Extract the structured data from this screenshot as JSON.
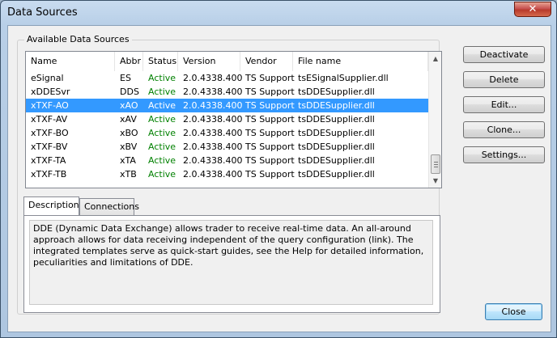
{
  "window": {
    "title": "Data Sources",
    "close_glyph": "✕"
  },
  "group": {
    "title": "Available Data Sources"
  },
  "table": {
    "columns": [
      "Name",
      "Abbr",
      "Status",
      "Version",
      "Vendor",
      "File name"
    ],
    "rows": [
      {
        "name": "eSignal",
        "abbr": "ES",
        "status": "Active",
        "version": "2.0.4338.400",
        "vendor": "TS Support",
        "file": "tsESignalSupplier.dll",
        "selected": false
      },
      {
        "name": "xDDESvr",
        "abbr": "DDS",
        "status": "Active",
        "version": "2.0.4338.400",
        "vendor": "TS Support",
        "file": "tsDDESupplier.dll",
        "selected": false
      },
      {
        "name": "xTXF-AO",
        "abbr": "xAO",
        "status": "Active",
        "version": "2.0.4338.400",
        "vendor": "TS Support",
        "file": "tsDDESupplier.dll",
        "selected": true
      },
      {
        "name": "xTXF-AV",
        "abbr": "xAV",
        "status": "Active",
        "version": "2.0.4338.400",
        "vendor": "TS Support",
        "file": "tsDDESupplier.dll",
        "selected": false
      },
      {
        "name": "xTXF-BO",
        "abbr": "xBO",
        "status": "Active",
        "version": "2.0.4338.400",
        "vendor": "TS Support",
        "file": "tsDDESupplier.dll",
        "selected": false
      },
      {
        "name": "xTXF-BV",
        "abbr": "xBV",
        "status": "Active",
        "version": "2.0.4338.400",
        "vendor": "TS Support",
        "file": "tsDDESupplier.dll",
        "selected": false
      },
      {
        "name": "xTXF-TA",
        "abbr": "xTA",
        "status": "Active",
        "version": "2.0.4338.400",
        "vendor": "TS Support",
        "file": "tsDDESupplier.dll",
        "selected": false
      },
      {
        "name": "xTXF-TB",
        "abbr": "xTB",
        "status": "Active",
        "version": "2.0.4338.400",
        "vendor": "TS Support",
        "file": "tsDDESupplier.dll",
        "selected": false
      }
    ],
    "status_color": "#008000",
    "selection_color": "#3399ff"
  },
  "tabs": [
    {
      "label": "Description",
      "active": true
    },
    {
      "label": "Connections",
      "active": false
    }
  ],
  "description": "DDE (Dynamic Data Exchange) allows trader to receive real-time data. An all-around approach allows for data receiving independent of the query configuration (link). The integrated templates serve as quick-start guides, see the Help for detailed information, peculiarities and limitations of DDE.",
  "buttons": {
    "deactivate": "Deactivate",
    "delete": "Delete",
    "edit": "Edit...",
    "clone": "Clone...",
    "settings": "Settings...",
    "close": "Close"
  }
}
